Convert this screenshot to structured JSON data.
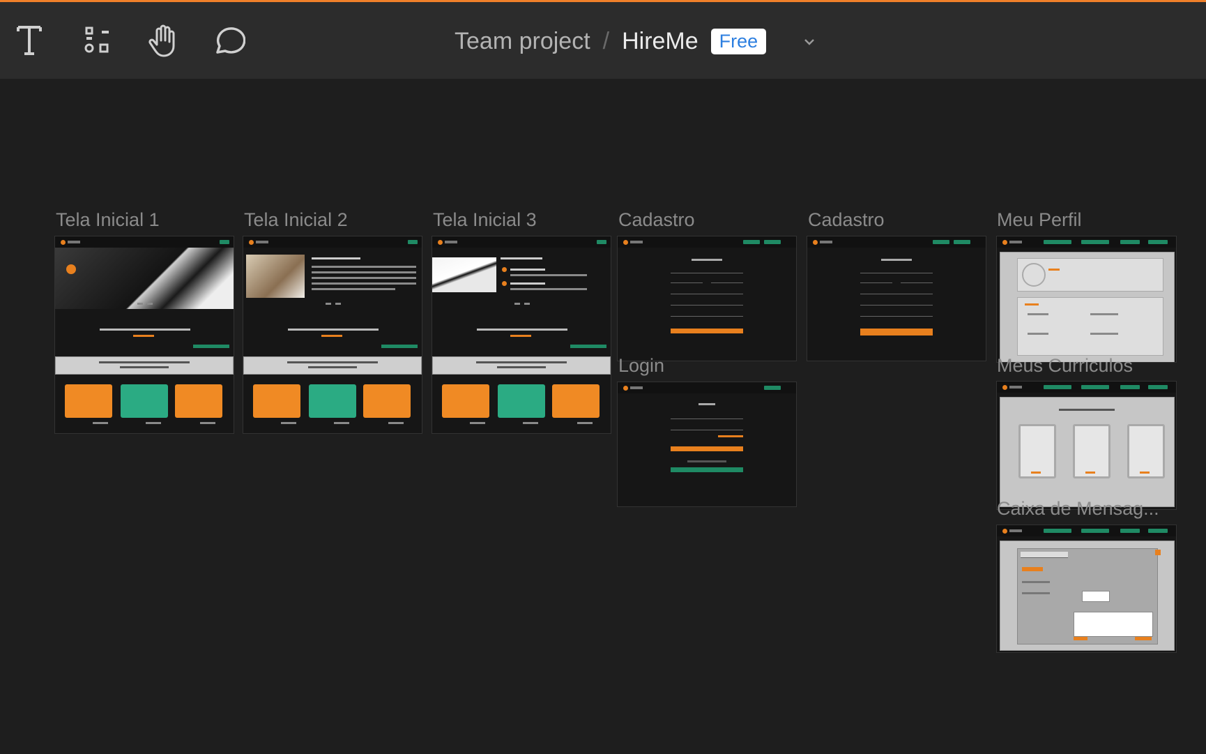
{
  "colors": {
    "accent": "#f0802a",
    "toolbar_bg": "#2c2c2c",
    "canvas_bg": "#1e1e1e",
    "badge_text": "#2d7fe0",
    "card_orange": "#f08a24",
    "card_green": "#2bab83",
    "nav_green": "#1f8a64"
  },
  "toolbar": {
    "tools": [
      {
        "name": "text-tool",
        "icon": "text-icon"
      },
      {
        "name": "components-tool",
        "icon": "components-icon"
      },
      {
        "name": "hand-tool",
        "icon": "hand-icon"
      },
      {
        "name": "comment-tool",
        "icon": "comment-icon"
      }
    ],
    "breadcrumb": {
      "team": "Team project",
      "separator": "/",
      "file": "HireMe",
      "plan_badge": "Free"
    },
    "dropdown_icon": "chevron-down-icon"
  },
  "frames": {
    "tela1": "Tela Inicial 1",
    "tela2": "Tela Inicial 2",
    "tela3": "Tela Inicial 3",
    "cadastro1": "Cadastro",
    "cadastro2": "Cadastro",
    "login": "Login",
    "perfil": "Meu Perfil",
    "curriculos": "Meus Curriculos",
    "mensagens": "Caixa de Mensag..."
  }
}
